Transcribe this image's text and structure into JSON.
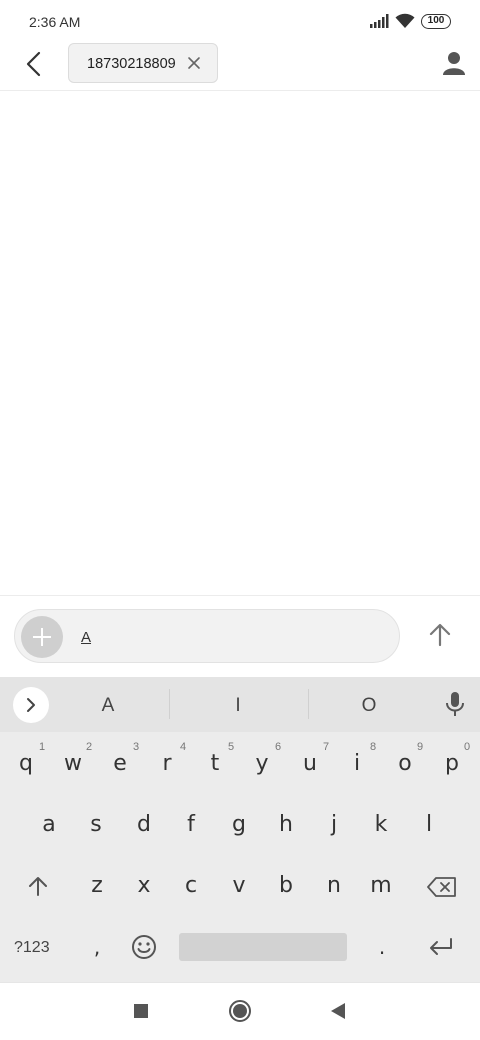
{
  "status_bar": {
    "time": "2:36 AM",
    "battery": "100"
  },
  "header": {
    "recipient": "18730218809"
  },
  "compose": {
    "text": "A"
  },
  "keyboard": {
    "suggestions": [
      "A",
      "I",
      "O"
    ],
    "row1": [
      "q",
      "w",
      "e",
      "r",
      "t",
      "y",
      "u",
      "i",
      "o",
      "p"
    ],
    "row1_hints": [
      "1",
      "2",
      "3",
      "4",
      "5",
      "6",
      "7",
      "8",
      "9",
      "0"
    ],
    "row2": [
      "a",
      "s",
      "d",
      "f",
      "g",
      "h",
      "j",
      "k",
      "l"
    ],
    "row3": [
      "z",
      "x",
      "c",
      "v",
      "b",
      "n",
      "m"
    ],
    "symbols_label": "?123",
    "comma": ",",
    "period": "."
  }
}
